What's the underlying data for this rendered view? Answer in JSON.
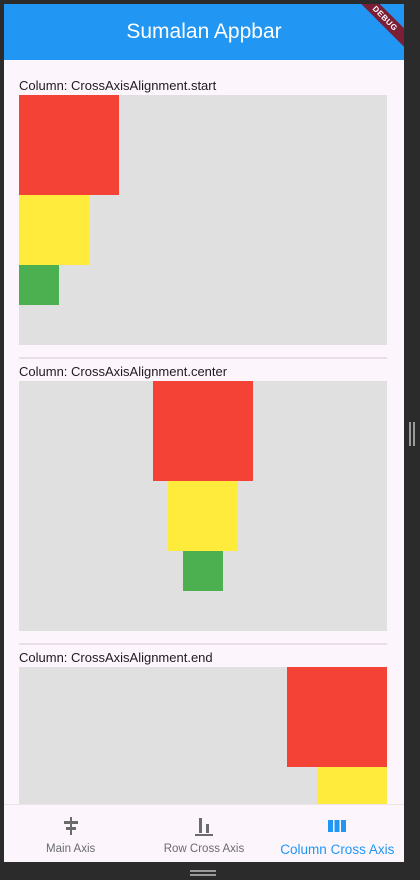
{
  "appbar": {
    "title": "Sumalan Appbar",
    "debug_banner": "DEBUG"
  },
  "sections": [
    {
      "label": "Column: CrossAxisAlignment.start"
    },
    {
      "label": "Column: CrossAxisAlignment.center"
    },
    {
      "label": "Column: CrossAxisAlignment.end"
    }
  ],
  "bottom_nav": {
    "items": [
      {
        "label": "Main Axis",
        "icon": "align-horizontal-center-icon"
      },
      {
        "label": "Row Cross Axis",
        "icon": "align-vertical-bottom-icon"
      },
      {
        "label": "Column Cross Axis",
        "icon": "view-column-icon"
      }
    ],
    "selected": "Column Cross Axis"
  },
  "colors": {
    "appbar": "#2196f3",
    "red_box": "#f44336",
    "yellow_box": "#ffeb3b",
    "green_box": "#4caf50",
    "container": "#e0e0e0",
    "nav_active": "#2196f3"
  }
}
